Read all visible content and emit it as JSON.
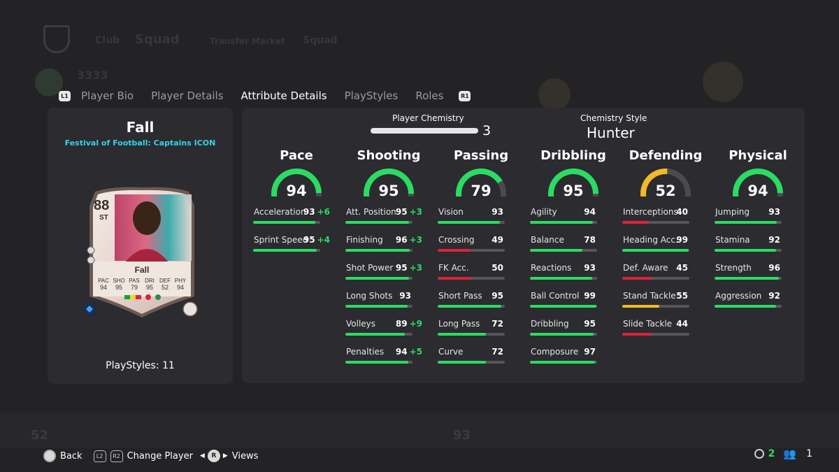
{
  "background": {
    "nav_items": [
      "Club",
      "Squad",
      "Transfer Market",
      "Squad"
    ],
    "rating": "3333"
  },
  "tabs": {
    "left_button": "L1",
    "right_button": "R1",
    "items": [
      "Player Bio",
      "Player Details",
      "Attribute Details",
      "PlayStyles",
      "Roles"
    ],
    "active": "Attribute Details"
  },
  "player": {
    "name": "Fall",
    "card_type": "Festival of Football: Captains ICON",
    "card": {
      "rating": "88",
      "position": "ST",
      "name": "Fall",
      "stat_labels": [
        "PAC",
        "SHO",
        "PAS",
        "DRI",
        "DEF",
        "PHY"
      ],
      "stat_values": [
        "94",
        "95",
        "79",
        "95",
        "52",
        "94"
      ]
    },
    "playstyles": "PlayStyles: 11"
  },
  "chemistry": {
    "label": "Player Chemistry",
    "value": "3",
    "style_label": "Chemistry Style",
    "style_name": "Hunter"
  },
  "colors": {
    "green": "#2bdc62",
    "yellow": "#f2b928",
    "red": "#d9243c",
    "track": "#55555a",
    "accent_cyan": "#34d3e6"
  },
  "categories": [
    {
      "name": "Pace",
      "value": "94",
      "fraction": 0.94,
      "color": "green",
      "stats": [
        {
          "name": "Acceleration",
          "value": "93",
          "bonus": "+6",
          "fraction": 0.93,
          "color": "green"
        },
        {
          "name": "Sprint Speed",
          "value": "95",
          "bonus": "+4",
          "fraction": 0.95,
          "color": "green"
        }
      ]
    },
    {
      "name": "Shooting",
      "value": "95",
      "fraction": 0.95,
      "color": "green",
      "stats": [
        {
          "name": "Att. Position",
          "value": "95",
          "bonus": "+3",
          "fraction": 0.95,
          "color": "green"
        },
        {
          "name": "Finishing",
          "value": "96",
          "bonus": "+3",
          "fraction": 0.96,
          "color": "green"
        },
        {
          "name": "Shot Power",
          "value": "95",
          "bonus": "+3",
          "fraction": 0.95,
          "color": "green"
        },
        {
          "name": "Long Shots",
          "value": "93",
          "bonus": "",
          "fraction": 0.93,
          "color": "green"
        },
        {
          "name": "Volleys",
          "value": "89",
          "bonus": "+9",
          "fraction": 0.89,
          "color": "green"
        },
        {
          "name": "Penalties",
          "value": "94",
          "bonus": "+5",
          "fraction": 0.94,
          "color": "green"
        }
      ]
    },
    {
      "name": "Passing",
      "value": "79",
      "fraction": 0.79,
      "color": "green",
      "stats": [
        {
          "name": "Vision",
          "value": "93",
          "bonus": "",
          "fraction": 0.93,
          "color": "green"
        },
        {
          "name": "Crossing",
          "value": "49",
          "bonus": "",
          "fraction": 0.49,
          "color": "red"
        },
        {
          "name": "FK Acc.",
          "value": "50",
          "bonus": "",
          "fraction": 0.5,
          "color": "red"
        },
        {
          "name": "Short Pass",
          "value": "95",
          "bonus": "",
          "fraction": 0.95,
          "color": "green"
        },
        {
          "name": "Long Pass",
          "value": "72",
          "bonus": "",
          "fraction": 0.72,
          "color": "green"
        },
        {
          "name": "Curve",
          "value": "72",
          "bonus": "",
          "fraction": 0.72,
          "color": "green"
        }
      ]
    },
    {
      "name": "Dribbling",
      "value": "95",
      "fraction": 0.95,
      "color": "green",
      "stats": [
        {
          "name": "Agility",
          "value": "94",
          "bonus": "",
          "fraction": 0.94,
          "color": "green"
        },
        {
          "name": "Balance",
          "value": "78",
          "bonus": "",
          "fraction": 0.78,
          "color": "green"
        },
        {
          "name": "Reactions",
          "value": "93",
          "bonus": "",
          "fraction": 0.93,
          "color": "green"
        },
        {
          "name": "Ball Control",
          "value": "99",
          "bonus": "",
          "fraction": 0.99,
          "color": "green"
        },
        {
          "name": "Dribbling",
          "value": "95",
          "bonus": "",
          "fraction": 0.95,
          "color": "green"
        },
        {
          "name": "Composure",
          "value": "97",
          "bonus": "",
          "fraction": 0.97,
          "color": "green"
        }
      ]
    },
    {
      "name": "Defending",
      "value": "52",
      "fraction": 0.52,
      "color": "yellow",
      "stats": [
        {
          "name": "Interceptions",
          "value": "40",
          "bonus": "",
          "fraction": 0.4,
          "color": "red"
        },
        {
          "name": "Heading Acc.",
          "value": "99",
          "bonus": "",
          "fraction": 0.99,
          "color": "green"
        },
        {
          "name": "Def. Aware",
          "value": "45",
          "bonus": "",
          "fraction": 0.45,
          "color": "red"
        },
        {
          "name": "Stand Tackle",
          "value": "55",
          "bonus": "",
          "fraction": 0.55,
          "color": "yellow"
        },
        {
          "name": "Slide Tackle",
          "value": "44",
          "bonus": "",
          "fraction": 0.44,
          "color": "red"
        }
      ]
    },
    {
      "name": "Physical",
      "value": "94",
      "fraction": 0.94,
      "color": "green",
      "stats": [
        {
          "name": "Jumping",
          "value": "93",
          "bonus": "",
          "fraction": 0.93,
          "color": "green"
        },
        {
          "name": "Stamina",
          "value": "92",
          "bonus": "",
          "fraction": 0.92,
          "color": "green"
        },
        {
          "name": "Strength",
          "value": "96",
          "bonus": "",
          "fraction": 0.96,
          "color": "green"
        },
        {
          "name": "Aggression",
          "value": "92",
          "bonus": "",
          "fraction": 0.92,
          "color": "green"
        }
      ]
    }
  ],
  "footer": {
    "back_label": "Back",
    "l2": "L2",
    "r2": "R2",
    "change_label": "Change Player",
    "r_stick": "R",
    "views_label": "Views",
    "count_a": "2",
    "count_b": "1"
  }
}
